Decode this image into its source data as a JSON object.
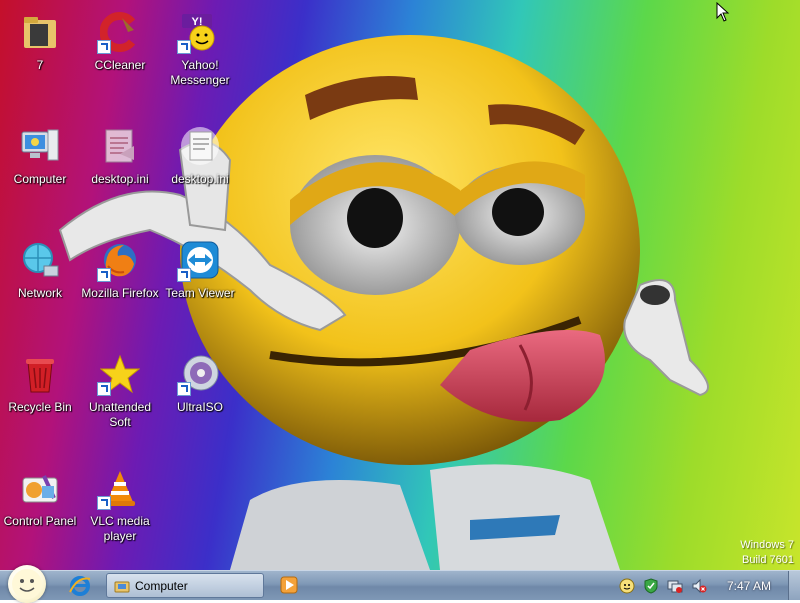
{
  "desktop": {
    "icons": [
      {
        "label": "7",
        "icon": "folder-icon"
      },
      {
        "label": "CCleaner",
        "icon": "ccleaner-icon"
      },
      {
        "label": "Yahoo! Messenger",
        "icon": "yahoo-messenger-icon"
      },
      {
        "label": "Computer",
        "icon": "computer-icon"
      },
      {
        "label": "desktop.ini",
        "icon": "ini-file-icon"
      },
      {
        "label": "desktop.ini",
        "icon": "ini-file-icon"
      },
      {
        "label": "Network",
        "icon": "network-icon"
      },
      {
        "label": "Mozilla Firefox",
        "icon": "firefox-icon"
      },
      {
        "label": "Team Viewer",
        "icon": "teamviewer-icon"
      },
      {
        "label": "Recycle Bin",
        "icon": "recycle-bin-icon"
      },
      {
        "label": "Unattended Soft",
        "icon": "star-icon"
      },
      {
        "label": "UltraISO",
        "icon": "ultraiso-icon"
      },
      {
        "label": "Control Panel",
        "icon": "control-panel-icon"
      },
      {
        "label": "VLC media player",
        "icon": "vlc-icon"
      }
    ],
    "watermark": {
      "line1": "Windows 7",
      "line2": "Build 7601"
    }
  },
  "taskbar": {
    "start_icon": "smiley-start-orb-icon",
    "pinned": [
      {
        "name": "internet-explorer",
        "icon": "internet-explorer-icon"
      },
      {
        "name": "media-player",
        "icon": "media-player-icon"
      }
    ],
    "open_window": {
      "label": "Computer",
      "icon": "computer-folder-icon"
    },
    "tray_icons": [
      "yahoo-tray-icon",
      "security-shield-icon",
      "network-tray-icon",
      "volume-muted-icon"
    ],
    "clock": "7:47 AM"
  },
  "colors": {
    "taskbar": "#7f98b6",
    "smiley_yellow": "#f2c21a",
    "tongue": "#d9485f"
  }
}
